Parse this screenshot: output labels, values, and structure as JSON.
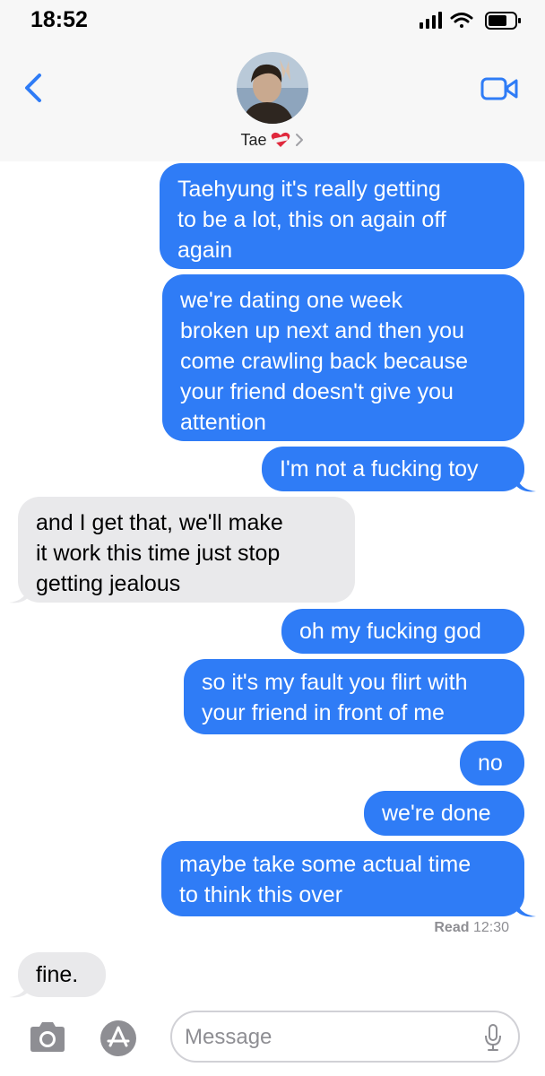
{
  "status_bar": {
    "time": "18:52"
  },
  "header": {
    "contact_name": "Tae"
  },
  "messages": [
    {
      "from": "me",
      "lines": [
        "Taehyung it's really getting",
        "to be a lot, this on again off",
        "again"
      ]
    },
    {
      "from": "me",
      "lines": [
        "we're dating one week",
        "broken up next and then you",
        "come crawling back because",
        "your friend doesn't give you",
        "attention"
      ]
    },
    {
      "from": "me",
      "lines": [
        "I'm not a fucking toy"
      ]
    },
    {
      "from": "them",
      "lines": [
        "and I get that, we'll make",
        "it work this time just stop",
        "getting jealous"
      ]
    },
    {
      "from": "me",
      "lines": [
        "oh my fucking god"
      ]
    },
    {
      "from": "me",
      "lines": [
        "so it's my fault you flirt with",
        "your friend in front of me"
      ]
    },
    {
      "from": "me",
      "lines": [
        "no"
      ]
    },
    {
      "from": "me",
      "lines": [
        "we're done"
      ]
    },
    {
      "from": "me",
      "lines": [
        "maybe take some actual time",
        "to think this over"
      ]
    },
    {
      "from": "them",
      "lines": [
        "fine."
      ]
    }
  ],
  "read_receipt": {
    "label": "Read",
    "time": "12:30"
  },
  "composer": {
    "placeholder": "Message"
  },
  "colors": {
    "sent_bubble": "#2f7cf6",
    "received_bubble": "#e9e9eb",
    "accent": "#2f7cf6"
  },
  "icons": [
    "signal-icon",
    "wifi-icon",
    "battery-icon",
    "back-chevron-icon",
    "video-call-icon",
    "camera-icon",
    "app-store-icon",
    "microphone-icon"
  ]
}
